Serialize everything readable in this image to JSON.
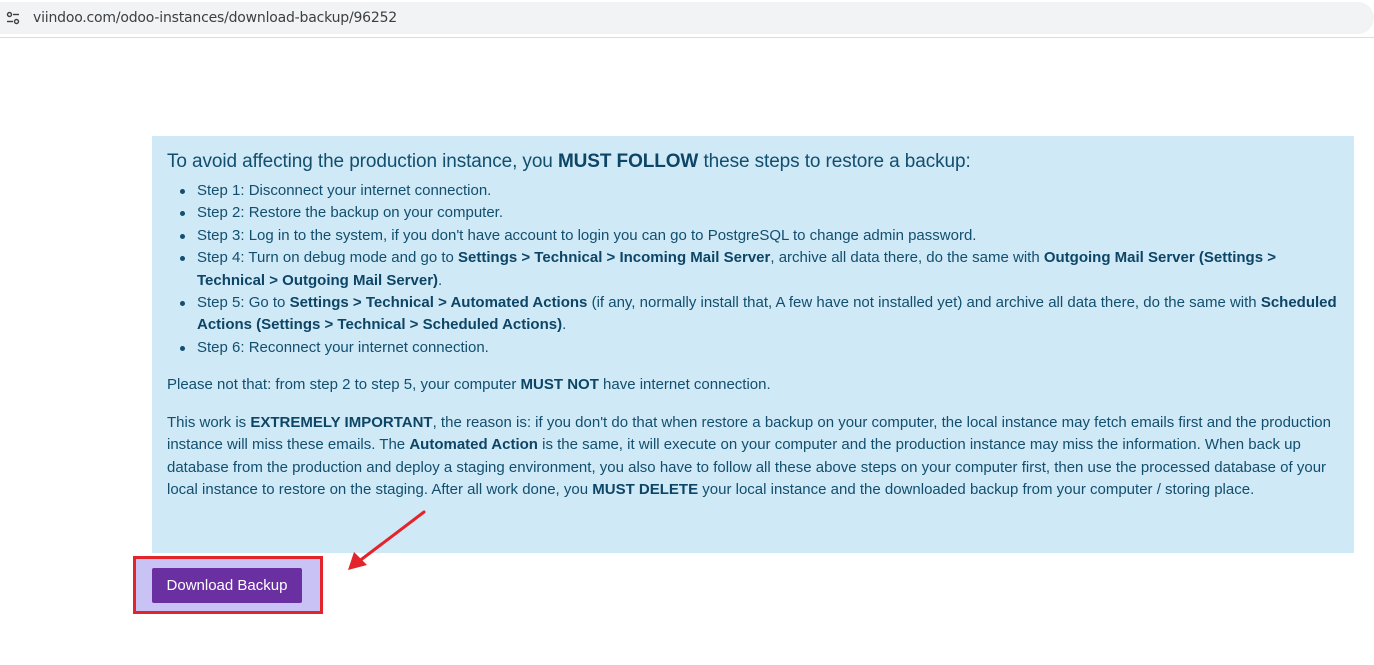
{
  "browser": {
    "url": "viindoo.com/odoo-instances/download-backup/96252",
    "site_info_icon": "site-settings-icon"
  },
  "notice": {
    "headline_pre": "To avoid affecting the production instance, you ",
    "headline_bold": "MUST FOLLOW",
    "headline_post": " these steps to restore a backup:",
    "steps": [
      {
        "parts": [
          {
            "t": "Step 1: Disconnect your internet connection.",
            "b": false
          }
        ]
      },
      {
        "parts": [
          {
            "t": "Step 2: Restore the backup on your computer.",
            "b": false
          }
        ]
      },
      {
        "parts": [
          {
            "t": "Step 3: Log in to the system, if you don't have account to login you can go to PostgreSQL to change admin password.",
            "b": false
          }
        ]
      },
      {
        "parts": [
          {
            "t": "Step 4: Turn on debug mode and go to ",
            "b": false
          },
          {
            "t": "Settings > Technical > Incoming Mail Server",
            "b": true
          },
          {
            "t": ", archive all data there, do the same with ",
            "b": false
          },
          {
            "t": "Outgoing Mail Server (Settings > Technical > Outgoing Mail Server)",
            "b": true
          },
          {
            "t": ".",
            "b": false
          }
        ]
      },
      {
        "parts": [
          {
            "t": "Step 5: Go to ",
            "b": false
          },
          {
            "t": "Settings > Technical > Automated Actions",
            "b": true
          },
          {
            "t": " (if any, normally install that, A few have not installed yet) and archive all data there, do the same with ",
            "b": false
          },
          {
            "t": "Scheduled Actions (Settings > Technical > Scheduled Actions)",
            "b": true
          },
          {
            "t": ".",
            "b": false
          }
        ]
      },
      {
        "parts": [
          {
            "t": "Step 6: Reconnect your internet connection.",
            "b": false
          }
        ]
      }
    ],
    "note_parts": [
      {
        "t": "Please not that: from step 2 to step 5, your computer ",
        "b": false
      },
      {
        "t": "MUST NOT",
        "b": true
      },
      {
        "t": " have internet connection.",
        "b": false
      }
    ],
    "warning_parts": [
      {
        "t": "This work is ",
        "b": false
      },
      {
        "t": "EXTREMELY IMPORTANT",
        "b": true
      },
      {
        "t": ", the reason is: if you don't do that when restore a backup on your computer, the local instance may fetch emails first and the production instance will miss these emails. The ",
        "b": false
      },
      {
        "t": "Automated Action",
        "b": true
      },
      {
        "t": " is the same, it will execute on your computer and the production instance may miss the information. When back up database from the production and deploy a staging environment, you also have to follow all these above steps on your computer first, then use the processed database of your local instance to restore on the staging. After all work done, you ",
        "b": false
      },
      {
        "t": "MUST DELETE",
        "b": true
      },
      {
        "t": " your local instance and the downloaded backup from your computer / storing place.",
        "b": false
      }
    ]
  },
  "actions": {
    "download_label": "Download Backup"
  },
  "colors": {
    "notice_bg": "#cfe9f7",
    "button_bg": "#6a2fa0",
    "highlight_border": "#e3242b",
    "arrow": "#e3242b"
  }
}
